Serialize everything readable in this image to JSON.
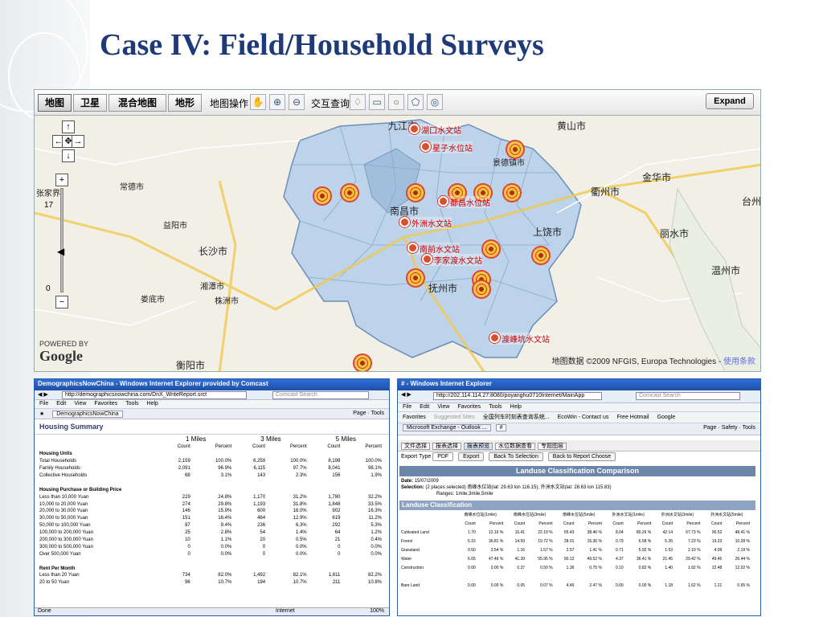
{
  "slide": {
    "title": "Case IV: Field/Household Surveys"
  },
  "map": {
    "tabs": [
      "地图",
      "卫星",
      "混合地图",
      "地形"
    ],
    "tool_label": "地图操作",
    "query_label": "交互查询",
    "expand_label": "Expand",
    "zoom_level": "17",
    "zoom_min": "0",
    "copyright": "地图数据 ©2009 NFGIS, Europa Technologies - ",
    "terms": "使用条款",
    "powered_by": "POWERED BY",
    "google": "Google",
    "cities": [
      {
        "name": "九江市"
      },
      {
        "name": "黄山市"
      },
      {
        "name": "常德市"
      },
      {
        "name": "益阳市"
      },
      {
        "name": "长沙市"
      },
      {
        "name": "湘潭市"
      },
      {
        "name": "株洲市"
      },
      {
        "name": "娄底市"
      },
      {
        "name": "衡阳市"
      },
      {
        "name": "南昌市"
      },
      {
        "name": "抚州市"
      },
      {
        "name": "上饶市"
      },
      {
        "name": "衢州市"
      },
      {
        "name": "金华市"
      },
      {
        "name": "丽水市"
      },
      {
        "name": "温州市"
      },
      {
        "name": "台州"
      },
      {
        "name": "景德镇市"
      },
      {
        "name": "张家界"
      }
    ],
    "stations": [
      {
        "name": "湖口水文站"
      },
      {
        "name": "星子水位站"
      },
      {
        "name": "都昌水位站"
      },
      {
        "name": "外洲水文站"
      },
      {
        "name": "南前水文站"
      },
      {
        "name": "李家渡水文站"
      },
      {
        "name": "渡峰坑水文站"
      }
    ]
  },
  "win1": {
    "title": "DemographicsNowChina - Windows Internet Explorer provided by Comcast",
    "address": "http://demographicsnowchina.com/DnX_WriteReport.srct",
    "search_placeholder": "Comcast Search",
    "menu": [
      "File",
      "Edit",
      "View",
      "Favorites",
      "Tools",
      "Help"
    ],
    "tab": "DemographicsNowChina",
    "page_menu": "Page",
    "tools_menu": "Tools",
    "report_title": "Housing Summary",
    "radii": [
      "1 Miles",
      "3 Miles",
      "5 Miles"
    ],
    "col_count": "Count",
    "col_percent": "Percent",
    "rows": [
      {
        "label": "Housing Units",
        "section": true,
        "v": [
          "",
          "",
          "",
          "",
          "",
          ""
        ]
      },
      {
        "label": "Total Households",
        "v": [
          "2,159",
          "100.0%",
          "6,259",
          "100.0%",
          "8,198",
          "100.0%"
        ]
      },
      {
        "label": "Family Households",
        "v": [
          "2,091",
          "96.9%",
          "6,115",
          "97.7%",
          "8,041",
          "98.1%"
        ]
      },
      {
        "label": "Collective Households",
        "v": [
          "68",
          "3.1%",
          "143",
          "2.3%",
          "156",
          "1.9%"
        ]
      },
      {
        "label": "",
        "v": [
          "",
          "",
          "",
          "",
          "",
          ""
        ]
      },
      {
        "label": "Housing Purchase or Building Price",
        "section": true,
        "v": [
          "",
          "",
          "",
          "",
          "",
          ""
        ]
      },
      {
        "label": "Less than 10,000 Yuan",
        "v": [
          "229",
          "24.8%",
          "1,170",
          "31.2%",
          "1,780",
          "32.2%"
        ]
      },
      {
        "label": "10,000 to 20,000 Yuan",
        "v": [
          "274",
          "29.8%",
          "1,193",
          "31.8%",
          "1,848",
          "33.5%"
        ]
      },
      {
        "label": "20,000 to 30,000 Yuan",
        "v": [
          "146",
          "15.9%",
          "600",
          "16.0%",
          "902",
          "16.3%"
        ]
      },
      {
        "label": "30,000 to 50,000 Yuan",
        "v": [
          "151",
          "16.4%",
          "484",
          "12.9%",
          "619",
          "11.2%"
        ]
      },
      {
        "label": "50,000 to 100,000 Yuan",
        "v": [
          "87",
          "9.4%",
          "236",
          "6.3%",
          "292",
          "5.3%"
        ]
      },
      {
        "label": "100,000 to 200,000 Yuan",
        "v": [
          "25",
          "2.8%",
          "54",
          "1.4%",
          "64",
          "1.2%"
        ]
      },
      {
        "label": "200,000 to 300,000 Yuan",
        "v": [
          "10",
          "1.1%",
          "20",
          "0.5%",
          "21",
          "0.4%"
        ]
      },
      {
        "label": "300,000 to 500,000 Yuan",
        "v": [
          "0",
          "0.0%",
          "0",
          "0.0%",
          "0",
          "0.0%"
        ]
      },
      {
        "label": "Over 500,000 Yuan",
        "v": [
          "0",
          "0.0%",
          "0",
          "0.0%",
          "0",
          "0.0%"
        ]
      },
      {
        "label": "",
        "v": [
          "",
          "",
          "",
          "",
          "",
          ""
        ]
      },
      {
        "label": "Rent Per Month",
        "section": true,
        "v": [
          "",
          "",
          "",
          "",
          "",
          ""
        ]
      },
      {
        "label": "Less than 20 Yuan",
        "v": [
          "734",
          "82.0%",
          "1,492",
          "82.1%",
          "1,611",
          "82.2%"
        ]
      },
      {
        "label": "20 to 50 Yuan",
        "v": [
          "96",
          "10.7%",
          "194",
          "10.7%",
          "211",
          "10.8%"
        ]
      }
    ],
    "status_left": "Done",
    "status_zone": "Internet",
    "zoom": "100%"
  },
  "win2": {
    "title": "# - Windows Internet Explorer",
    "address": "http://202.114.114.27:8080/poyanghu0710Internet/MainApp",
    "search_placeholder": "Comcast Search",
    "menu": [
      "File",
      "Edit",
      "View",
      "Favorites",
      "Tools",
      "Help"
    ],
    "favorites": [
      "Favorites",
      "Suggested Sites",
      "全国列车时刻表查询系统...",
      "EcoWin - Contact us",
      "Free Hotmail",
      "Google"
    ],
    "tab": "Microsoft Exchange - Outlook ...",
    "tab2": "#",
    "toolbar_items": [
      "Page",
      "Safety",
      "Tools"
    ],
    "app_tabs": [
      "文件选择",
      "报表选择",
      "报表预览",
      "水位数据查看",
      "专题图层"
    ],
    "export_type_label": "Export Type",
    "export_type_value": "PDF",
    "buttons": [
      "Export",
      "Back To Selection",
      "Back to Report Choose"
    ],
    "report_title": "Landuse Classification Comparison",
    "date_label": "Date:",
    "date_value": "15/07/2009",
    "selection_label": "Selection:",
    "selection_value": "(2 places selected) 南峰水位站(lat: 29.63 lon 116.15),  外洲水文站(lat: 28.63 lon 115.83)",
    "ranges": "Ranges: 1mile,3mile,5mile",
    "section": "Landuse Classification",
    "groups": [
      "南峰水位站(1mile)",
      "南峰水位站(3mile)",
      "南峰水位站(5mile)",
      "外洲水文站(1mile)",
      "外洲水文站(3mile)",
      "外洲水文站(5mile)"
    ],
    "col_count": "Count",
    "col_percent": "Percent",
    "rows": [
      {
        "label": "Cultivated Land",
        "v": [
          "1.70",
          "12.16 %",
          "16.41",
          "22.19 %",
          "55.43",
          "38.46 %",
          "8.04",
          "80.26 %",
          "42.14",
          "67.73 %",
          "90.52",
          "48.41 %"
        ]
      },
      {
        "label": "Forest",
        "v": [
          "5.15",
          "36.81 %",
          "14.59",
          "19.72 %",
          "28.01",
          "15.36 %",
          "0.79",
          "6.58 %",
          "5.26",
          "7.23 %",
          "19.23",
          "10.28 %"
        ]
      },
      {
        "label": "Grassland",
        "v": [
          "0.50",
          "3.54 %",
          "1.16",
          "1.57 %",
          "2.57",
          "1.41 %",
          "0.71",
          "5.92 %",
          "1.53",
          "2.10 %",
          "4.09",
          "2.19 %"
        ]
      },
      {
        "label": "Water",
        "v": [
          "6.65",
          "47.49 %",
          "41.39",
          "55.95 %",
          "90.12",
          "49.52 %",
          "4.37",
          "36.41 %",
          "21.45",
          "29.42 %",
          "49.45",
          "26.44 %"
        ]
      },
      {
        "label": "Construction",
        "v": [
          "0.00",
          "0.00 %",
          "0.37",
          "0.50 %",
          "1.36",
          "0.75 %",
          "0.10",
          "0.82 %",
          "1.40",
          "1.92 %",
          "22.48",
          "12.02 %"
        ]
      },
      {
        "label": "",
        "v": [
          "",
          "",
          "",
          "",
          "",
          "",
          "",
          "",
          "",
          "",
          "",
          ""
        ]
      },
      {
        "label": "Bare Land",
        "v": [
          "0.00",
          "0.00 %",
          "0.05",
          "0.07 %",
          "4.49",
          "2.47 %",
          "0.00",
          "0.00 %",
          "1.18",
          "1.62 %",
          "1.21",
          "0.65 %"
        ]
      }
    ]
  },
  "colors": {
    "title": "#1f3a78",
    "water_region": "#bcd3ea",
    "ie_blue": "#2e6fd8",
    "station_red": "#d6502a"
  }
}
